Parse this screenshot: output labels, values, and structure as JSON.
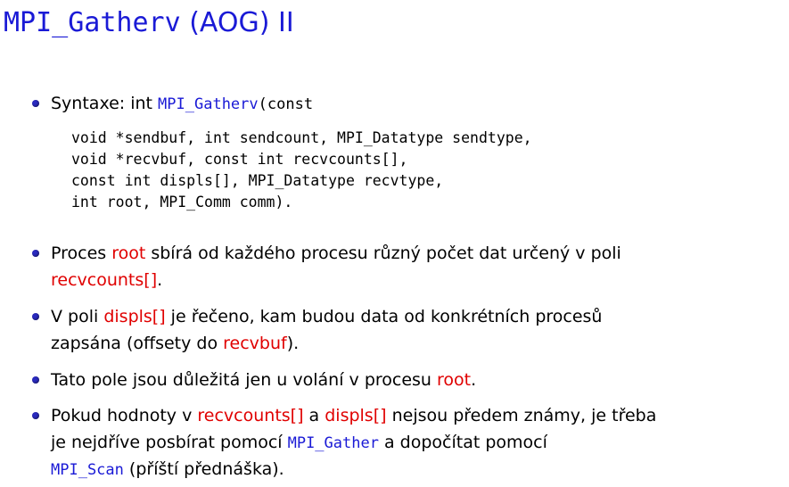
{
  "slide": {
    "title_mono": "MPI_Gatherv",
    "title_rest": " (AOG) II"
  },
  "b1": {
    "lead": "Syntaxe: int ",
    "func": "MPI_Gatherv",
    "tail": "(const",
    "code": [
      "void *sendbuf, int sendcount, MPI_Datatype sendtype,",
      "void *recvbuf, const int recvcounts[],",
      "const int displs[], MPI_Datatype recvtype,",
      "int root, MPI_Comm comm)."
    ]
  },
  "b2": {
    "t1": "Proces ",
    "h1": "root",
    "t2": " sbírá od každého procesu různý počet dat určený v poli",
    "h2": "recvcounts[]",
    "t3": "."
  },
  "b3": {
    "t1": "V poli ",
    "h1": "displs[]",
    "t2": " je řečeno, kam budou data od konkrétních procesů",
    "t3": "zapsána (offsety do ",
    "h2": "recvbuf",
    "t4": ")."
  },
  "b4": {
    "t1": "Tato pole jsou důležitá jen u volání v procesu ",
    "h1": "root",
    "t2": "."
  },
  "b5": {
    "t1": "Pokud hodnoty v ",
    "h1": "recvcounts[]",
    "t2": " a ",
    "h2": "displs[]",
    "t3": " nejsou předem známy, je třeba",
    "t4": "je nejdříve posbírat pomocí ",
    "c1": "MPI_Gather",
    "t5": " a dopočítat pomocí",
    "c2": "MPI_Scan",
    "t6": " (příští přednáška)."
  },
  "colors": {
    "title": "#1a1ad6",
    "keyword_red": "#e00000",
    "bullet": "#2a2ac0"
  }
}
